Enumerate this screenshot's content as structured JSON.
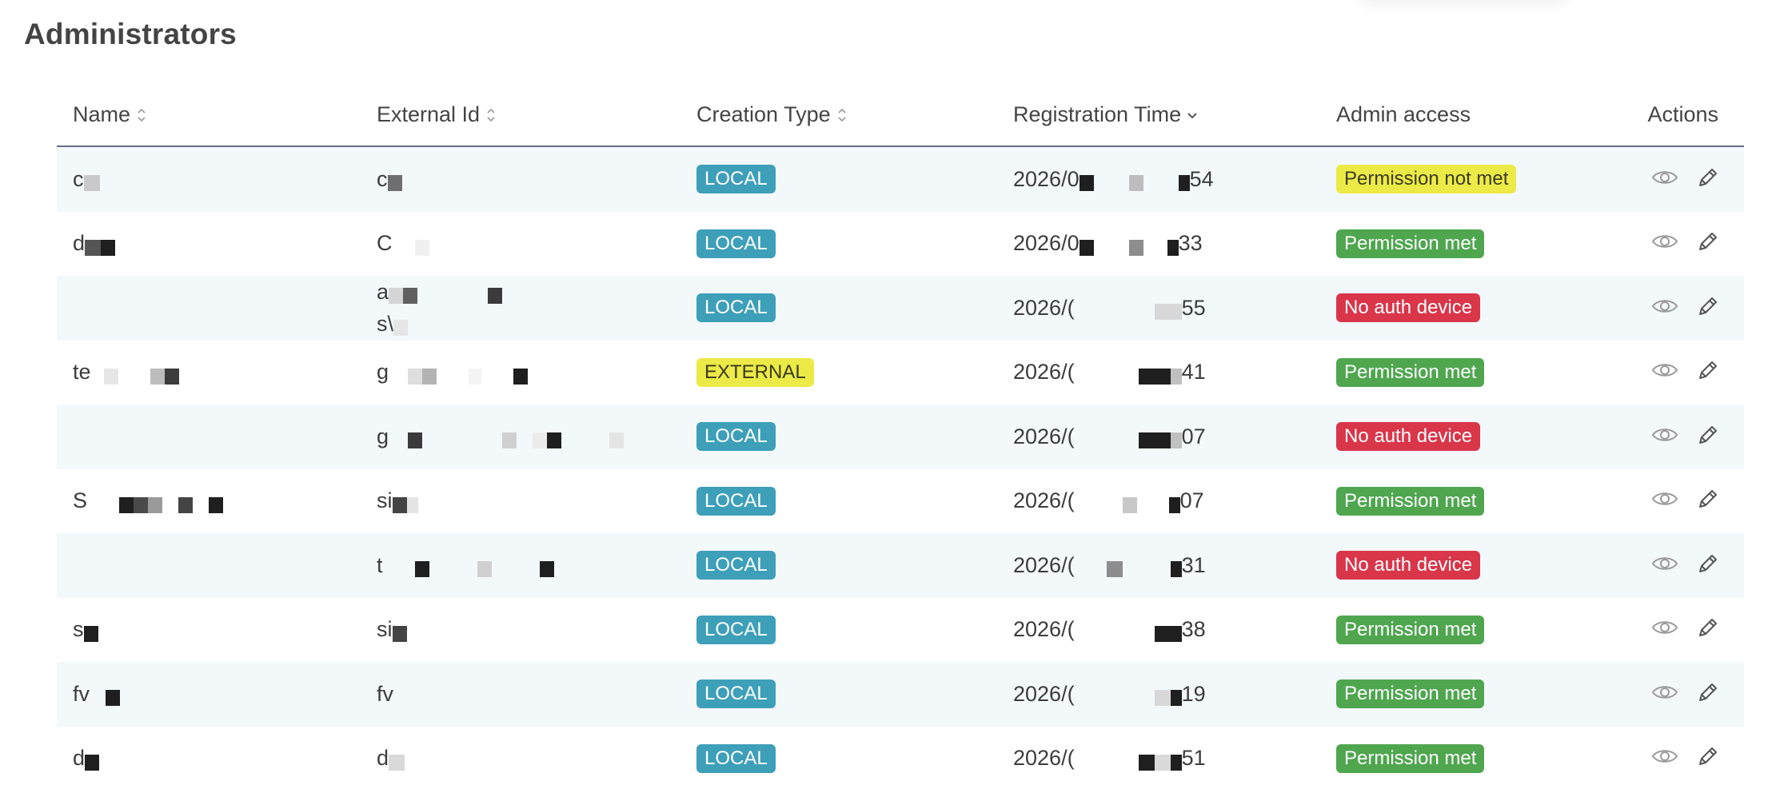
{
  "page": {
    "title": "Administrators"
  },
  "table": {
    "headers": {
      "name": "Name",
      "external_id": "External Id",
      "creation_type": "Creation Type",
      "registration_time": "Registration Time",
      "admin_access": "Admin access",
      "actions": "Actions"
    },
    "sort": {
      "name": "sortable",
      "external_id": "sortable",
      "creation_type": "sortable",
      "registration_time": "descending"
    },
    "rows": [
      {
        "name": "c",
        "external_id": "c",
        "external_id_2": "",
        "creation_type": "LOCAL",
        "registration_time_prefix": "2026/0",
        "registration_time_suffix": "54",
        "admin_access": "Permission not met",
        "access_status": "not-met"
      },
      {
        "name": "d",
        "external_id": "C",
        "external_id_2": "",
        "creation_type": "LOCAL",
        "registration_time_prefix": "2026/0",
        "registration_time_suffix": "33",
        "admin_access": "Permission met",
        "access_status": "met"
      },
      {
        "name": "",
        "external_id": "a",
        "external_id_2": "s\\",
        "creation_type": "LOCAL",
        "registration_time_prefix": "2026/(",
        "registration_time_suffix": "55",
        "admin_access": "No auth device",
        "access_status": "no-auth"
      },
      {
        "name": "te",
        "external_id": "g",
        "external_id_2": "",
        "creation_type": "EXTERNAL",
        "registration_time_prefix": "2026/(",
        "registration_time_suffix": "41",
        "admin_access": "Permission met",
        "access_status": "met"
      },
      {
        "name": "",
        "external_id": "g",
        "external_id_2": "",
        "creation_type": "LOCAL",
        "registration_time_prefix": "2026/(",
        "registration_time_suffix": "07",
        "admin_access": "No auth device",
        "access_status": "no-auth"
      },
      {
        "name": "S",
        "external_id": "si",
        "external_id_2": "",
        "creation_type": "LOCAL",
        "registration_time_prefix": "2026/(",
        "registration_time_suffix": "07",
        "admin_access": "Permission met",
        "access_status": "met"
      },
      {
        "name": "",
        "external_id": "t",
        "external_id_2": "",
        "creation_type": "LOCAL",
        "registration_time_prefix": "2026/(",
        "registration_time_suffix": "31",
        "admin_access": "No auth device",
        "access_status": "no-auth"
      },
      {
        "name": "s",
        "external_id": "si",
        "external_id_2": "",
        "creation_type": "LOCAL",
        "registration_time_prefix": "2026/(",
        "registration_time_suffix": "38",
        "admin_access": "Permission met",
        "access_status": "met"
      },
      {
        "name": "fv",
        "external_id": "fv",
        "external_id_2": "",
        "creation_type": "LOCAL",
        "registration_time_prefix": "2026/(",
        "registration_time_suffix": "19",
        "admin_access": "Permission met",
        "access_status": "met"
      },
      {
        "name": "d",
        "external_id": "d",
        "external_id_2": "",
        "creation_type": "LOCAL",
        "registration_time_prefix": "2026/(",
        "registration_time_suffix": "51",
        "admin_access": "Permission met",
        "access_status": "met"
      }
    ],
    "row_actions": [
      "eye-icon",
      "pencil-icon"
    ]
  },
  "colors": {
    "local_badge": "#3e9fb8",
    "external_badge": "#ecea47",
    "permission_not_met": "#ecea47",
    "permission_met": "#4fa64f",
    "no_auth_device": "#d9364a",
    "row_alt_background": "#f3f8fb",
    "header_rule": "#646e80"
  }
}
